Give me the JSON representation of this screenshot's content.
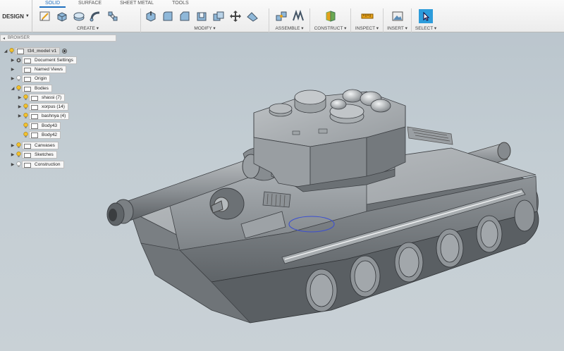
{
  "toolbar": {
    "workspace": "DESIGN",
    "tabs": [
      "SOLID",
      "SURFACE",
      "SHEET METAL",
      "TOOLS"
    ],
    "groups": {
      "create": "CREATE",
      "modify": "MODIFY",
      "assemble": "ASSEMBLE",
      "construct": "CONSTRUCT",
      "inspect": "INSPECT",
      "insert": "INSERT",
      "select": "SELECT"
    }
  },
  "browser": {
    "header": "BROWSER",
    "root": "t34_model v1",
    "items": {
      "document_settings": "Document Settings",
      "named_views": "Named Views",
      "origin": "Origin",
      "bodies": "Bodies",
      "shassi": "shassi (7)",
      "xorpus": "xorpus (14)",
      "bashnya": "bashnya (4)",
      "body43": "Body43",
      "body42": "Body42",
      "canvases": "Canvases",
      "sketches": "Sketches",
      "construction": "Construction"
    }
  },
  "colors": {
    "accent": "#1f6fbf",
    "select_tool": "#2d9cdb",
    "bulb": "#f2c12e",
    "viewport_bg": "#c3cdd3",
    "model_gray": "#8a8f93"
  },
  "icons": [
    "sketch-icon",
    "extrude-icon",
    "revolve-icon",
    "sweep-icon",
    "loft-icon",
    "press-pull-icon",
    "fillet-icon",
    "chamfer-icon",
    "shell-icon",
    "combine-icon",
    "move-icon",
    "align-icon",
    "joint-icon",
    "as-built-joint-icon",
    "offset-plane-icon",
    "measure-icon",
    "insert-image-icon",
    "select-icon"
  ]
}
